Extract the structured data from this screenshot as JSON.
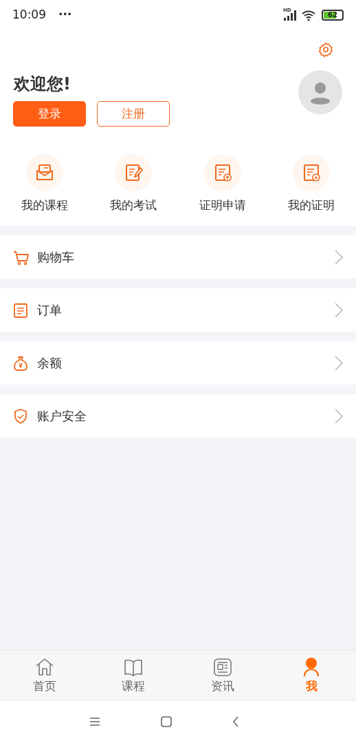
{
  "status_bar": {
    "time": "10:09",
    "dots": "···",
    "network": "HD",
    "battery": "62"
  },
  "header": {
    "greeting": "欢迎您!",
    "buttons": [
      {
        "label": "登录",
        "kind": "primary"
      },
      {
        "label": "注册",
        "kind": "outline"
      }
    ]
  },
  "quick_actions": [
    {
      "label": "我的课程",
      "kind": "course"
    },
    {
      "label": "我的考试",
      "kind": "exam"
    },
    {
      "label": "证明申请",
      "kind": "apply"
    },
    {
      "label": "我的证明",
      "kind": "certificate"
    }
  ],
  "menu": [
    {
      "label": "购物车",
      "kind": "cart"
    },
    {
      "label": "订单",
      "kind": "order"
    },
    {
      "label": "余额",
      "kind": "balance"
    },
    {
      "label": "账户安全",
      "kind": "security"
    }
  ],
  "tabs": [
    {
      "label": "首页",
      "kind": "home",
      "selected": false
    },
    {
      "label": "课程",
      "kind": "book",
      "selected": false
    },
    {
      "label": "资讯",
      "kind": "news",
      "selected": false
    },
    {
      "label": "我",
      "kind": "me",
      "selected": true
    }
  ]
}
